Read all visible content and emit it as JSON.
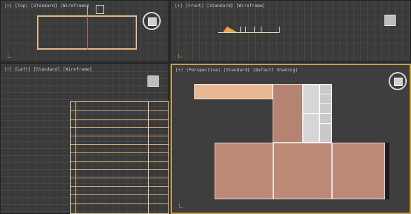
{
  "viewports": {
    "top": {
      "label": "[+] [Top] [Standard] [Wireframe]"
    },
    "front": {
      "label": "[+] [Front] [Standard] [Wireframe]"
    },
    "left": {
      "label": "[+] [Left] [Standard] [Wireframe]"
    },
    "persp": {
      "label": "[+] [Perspective] [Standard] [Default Shading]"
    }
  },
  "colors": {
    "active_border": "#c8a14a",
    "wall": "#b58372",
    "stair": "#e7b893",
    "grid_bg": "#3a3a3a"
  },
  "icons": [
    "viewcube-icon",
    "navigation-ring-icon",
    "axis-gizmo-icon"
  ]
}
